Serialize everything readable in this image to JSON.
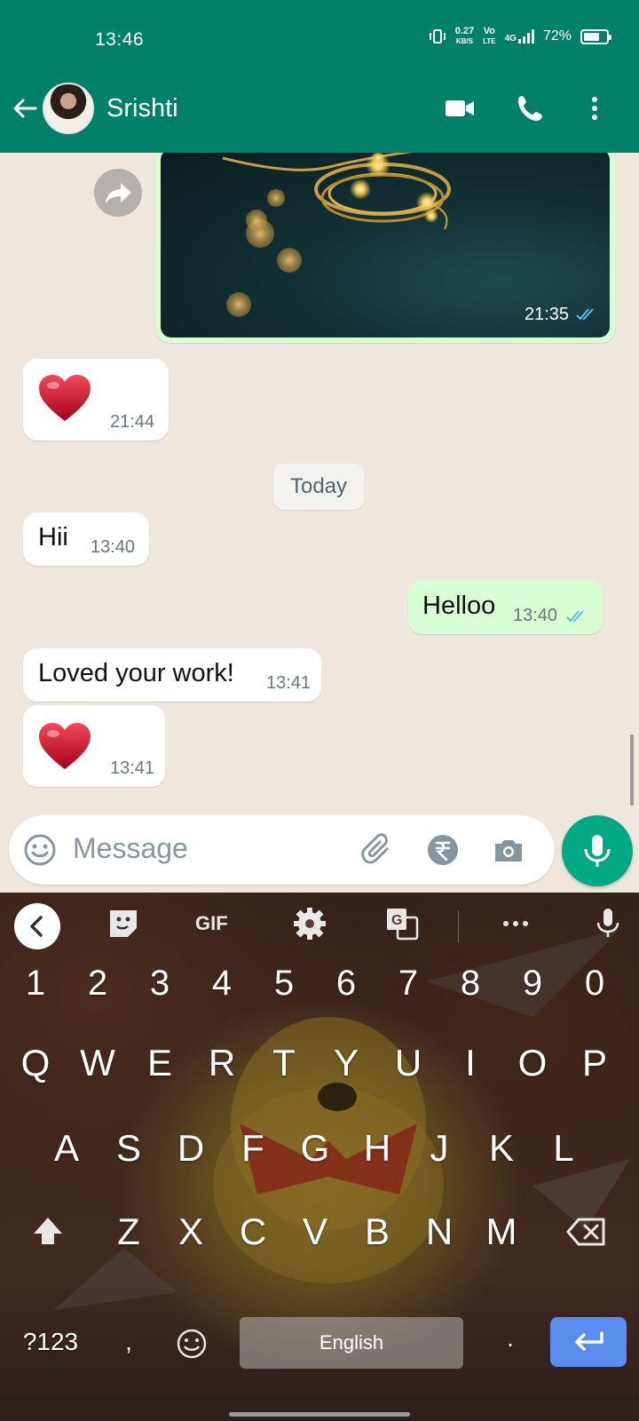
{
  "status_bar": {
    "time": "13:46",
    "net_speed_value": "0.27",
    "net_speed_unit": "KB/S",
    "volte_top": "Vo",
    "volte_bottom": "LTE",
    "network": "4G",
    "battery_pct": "72%",
    "battery_level": 0.72
  },
  "header": {
    "contact_name": "Srishti",
    "icons": [
      "back-arrow-icon",
      "video-call-icon",
      "voice-call-icon",
      "more-options-icon"
    ]
  },
  "chat": {
    "image_message": {
      "time": "21:35",
      "direction": "out",
      "read": true
    },
    "messages": [
      {
        "type": "emoji",
        "emoji": "heart",
        "time": "21:44",
        "direction": "in"
      },
      {
        "type": "text",
        "text": "Hii",
        "time": "13:40",
        "direction": "in"
      },
      {
        "type": "text",
        "text": "Helloo",
        "time": "13:40",
        "direction": "out",
        "read": true
      },
      {
        "type": "text",
        "text": "Loved your work!",
        "time": "13:41",
        "direction": "in"
      },
      {
        "type": "emoji",
        "emoji": "heart",
        "time": "13:41",
        "direction": "in"
      }
    ],
    "date_divider": "Today"
  },
  "composer": {
    "placeholder": "Message",
    "icons": [
      "emoji-icon",
      "attach-icon",
      "rupee-payment-icon",
      "camera-icon",
      "mic-icon"
    ]
  },
  "keyboard": {
    "toolbar": [
      "collapse-icon",
      "sticker-icon",
      "gif-icon",
      "settings-icon",
      "translate-icon",
      "more-icon",
      "voice-input-icon"
    ],
    "gif_label": "GIF",
    "number_row": [
      "1",
      "2",
      "3",
      "4",
      "5",
      "6",
      "7",
      "8",
      "9",
      "0"
    ],
    "row1": [
      "Q",
      "W",
      "E",
      "R",
      "T",
      "Y",
      "U",
      "I",
      "O",
      "P"
    ],
    "row2": [
      "A",
      "S",
      "D",
      "F",
      "G",
      "H",
      "J",
      "K",
      "L"
    ],
    "row3": [
      "Z",
      "X",
      "C",
      "V",
      "B",
      "N",
      "M"
    ],
    "symbols_label": "?123",
    "comma": ",",
    "period": ".",
    "space_label": "English"
  },
  "colors": {
    "header_bg": "#008069",
    "outgoing_bubble": "#d9fdd3",
    "incoming_bubble": "#ffffff",
    "read_tick": "#53bdeb",
    "mic_fab": "#00a884",
    "enter_key": "#5b8def"
  }
}
